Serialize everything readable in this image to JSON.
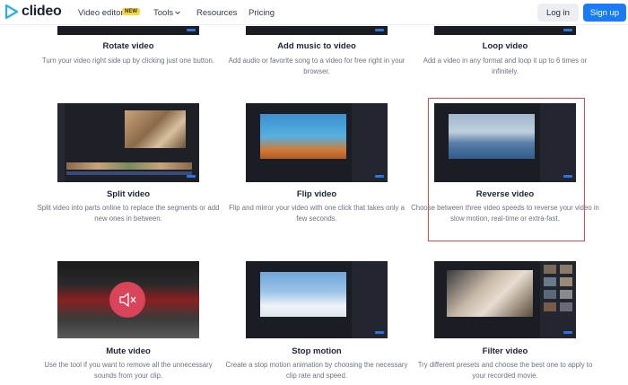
{
  "header": {
    "logo": "clideo",
    "nav": {
      "video_editor": "Video editor",
      "new_badge": "NEW",
      "tools": "Tools",
      "resources": "Resources",
      "pricing": "Pricing"
    },
    "login": "Log in",
    "signup": "Sign up"
  },
  "tools": [
    {
      "title": "Rotate video",
      "description": "Turn your video right side up by clicking just one button."
    },
    {
      "title": "Add music to video",
      "description": "Add audio or favorite song to a video for free right in your browser."
    },
    {
      "title": "Loop video",
      "description": "Add a video in any format and loop it up to 6 times or infinitely."
    },
    {
      "title": "Split video",
      "description": "Split video into parts online to replace the segments or add new ones in between."
    },
    {
      "title": "Flip video",
      "description": "Flip and mirror your video with one click that takes only a few seconds."
    },
    {
      "title": "Reverse video",
      "description": "Choose between three video speeds to reverse your video in slow motion, real-time or extra-fast."
    },
    {
      "title": "Mute video",
      "description": "Use the tool if you want to remove all the unnecessary sounds from your clip."
    },
    {
      "title": "Stop motion",
      "description": "Create a stop motion animation by choosing the necessary clip rate and speed."
    },
    {
      "title": "Filter video",
      "description": "Try different presets and choose the best one to apply to your recorded movie."
    }
  ],
  "colors": {
    "accent": "#1a7cf5",
    "highlight": "#e04a4a",
    "badge": "#f6d743"
  },
  "icons": {
    "mute": "speaker-mute-icon"
  }
}
